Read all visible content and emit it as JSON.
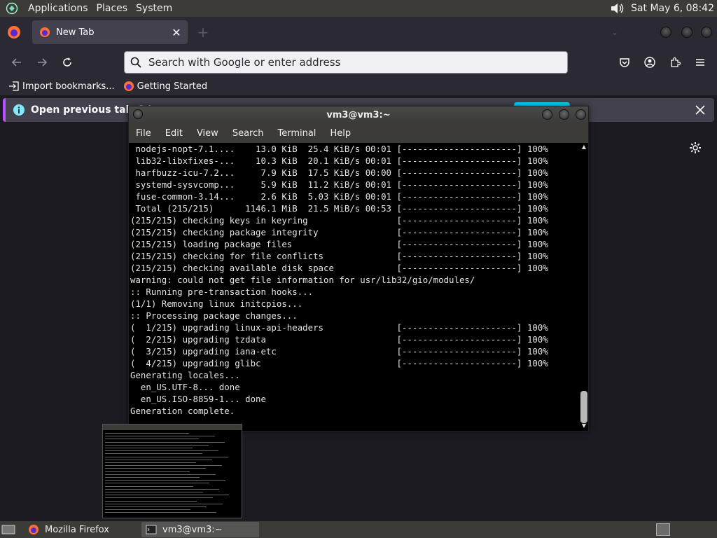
{
  "top_panel": {
    "menus": [
      "Applications",
      "Places",
      "System"
    ],
    "clock": "Sat May  6, 08:42"
  },
  "firefox": {
    "tab": {
      "title": "New Tab"
    },
    "urlbar": {
      "placeholder": "Search with Google or enter address"
    },
    "bookmarks": [
      "Import bookmarks...",
      "Getting Started"
    ],
    "notification": {
      "text": "Open previous tabs? ’"
    }
  },
  "terminal": {
    "title": "vm3@vm3:~",
    "menus": [
      "File",
      "Edit",
      "View",
      "Search",
      "Terminal",
      "Help"
    ],
    "lines": [
      " nodejs-nopt-7.1....    13.0 KiB  25.4 KiB/s 00:01 [----------------------] 100%",
      " lib32-libxfixes-...    10.3 KiB  20.1 KiB/s 00:01 [----------------------] 100%",
      " harfbuzz-icu-7.2...     7.9 KiB  17.5 KiB/s 00:00 [----------------------] 100%",
      " systemd-sysvcomp...     5.9 KiB  11.2 KiB/s 00:01 [----------------------] 100%",
      " fuse-common-3.14...     2.6 KiB  5.03 KiB/s 00:01 [----------------------] 100%",
      " Total (215/215)      1146.1 MiB  21.5 MiB/s 00:53 [----------------------] 100%",
      "(215/215) checking keys in keyring                 [----------------------] 100%",
      "(215/215) checking package integrity               [----------------------] 100%",
      "(215/215) loading package files                    [----------------------] 100%",
      "(215/215) checking for file conflicts              [----------------------] 100%",
      "(215/215) checking available disk space            [----------------------] 100%",
      "warning: could not get file information for usr/lib32/gio/modules/",
      ":: Running pre-transaction hooks...",
      "(1/1) Removing linux initcpios...",
      ":: Processing package changes...",
      "(  1/215) upgrading linux-api-headers              [----------------------] 100%",
      "(  2/215) upgrading tzdata                         [----------------------] 100%",
      "(  3/215) upgrading iana-etc                       [----------------------] 100%",
      "(  4/215) upgrading glibc                          [----------------------] 100%",
      "Generating locales...",
      "  en_US.UTF-8... done",
      "  en_US.ISO-8859-1... done",
      "Generation complete."
    ]
  },
  "taskbar": {
    "tasks": [
      "Mozilla Firefox",
      "vm3@vm3:~"
    ]
  },
  "colors": {
    "panel": "#3c3b37",
    "firefox_chrome": "#2b2a33",
    "notification_accent": "#00ddff",
    "terminal_bg": "#000000"
  }
}
